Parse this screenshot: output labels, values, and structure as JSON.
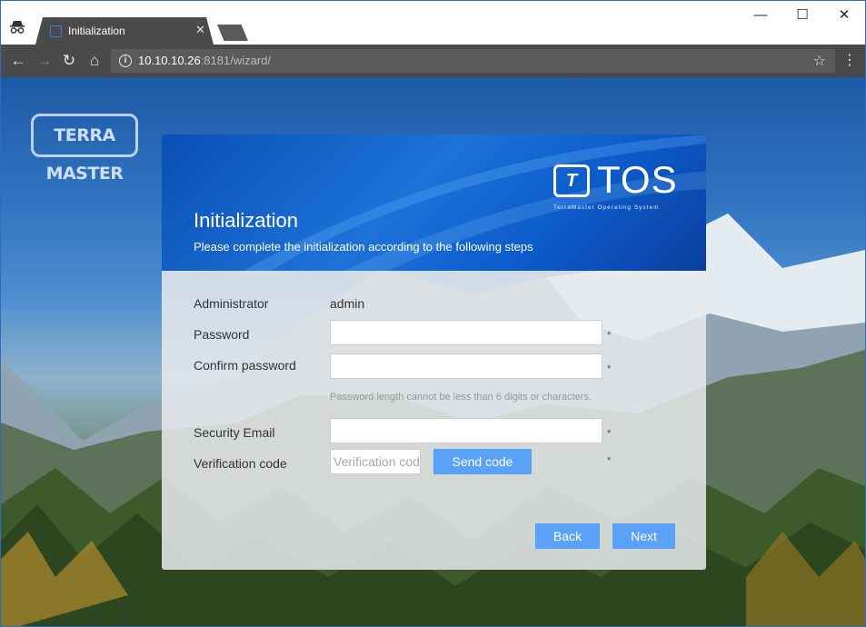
{
  "browser": {
    "tab_title": "Initialization",
    "url_host": "10.10.10.26",
    "url_rest": ":8181/wizard/",
    "icons": [
      "incognito-icon",
      "back-icon",
      "forward-icon",
      "reload-icon",
      "home-icon",
      "info-icon",
      "star-icon",
      "menu-icon",
      "minimize-icon",
      "maximize-icon",
      "close-icon"
    ]
  },
  "brand": {
    "terramaster_logo": "TERRA MASTER",
    "tos_mark": "T",
    "tos_name": "TOS",
    "tos_tagline": "TerraMaster Operating System"
  },
  "dialog": {
    "title": "Initialization",
    "subtitle": "Please complete the initialization according to the following steps",
    "administrator_label": "Administrator",
    "administrator_value": "admin",
    "password_label": "Password",
    "confirm_password_label": "Confirm password",
    "password_hint": "Password length cannot be less than 6 digits or characters.",
    "security_email_label": "Security Email",
    "verification_label": "Verification code",
    "verification_placeholder": "Verification code",
    "send_code_label": "Send code",
    "required_mark": "*",
    "back_label": "Back",
    "next_label": "Next"
  },
  "colors": {
    "accent": "#5aa2f7",
    "header_blue": "#1d72d8",
    "chrome_dark": "#4a4a4a"
  }
}
